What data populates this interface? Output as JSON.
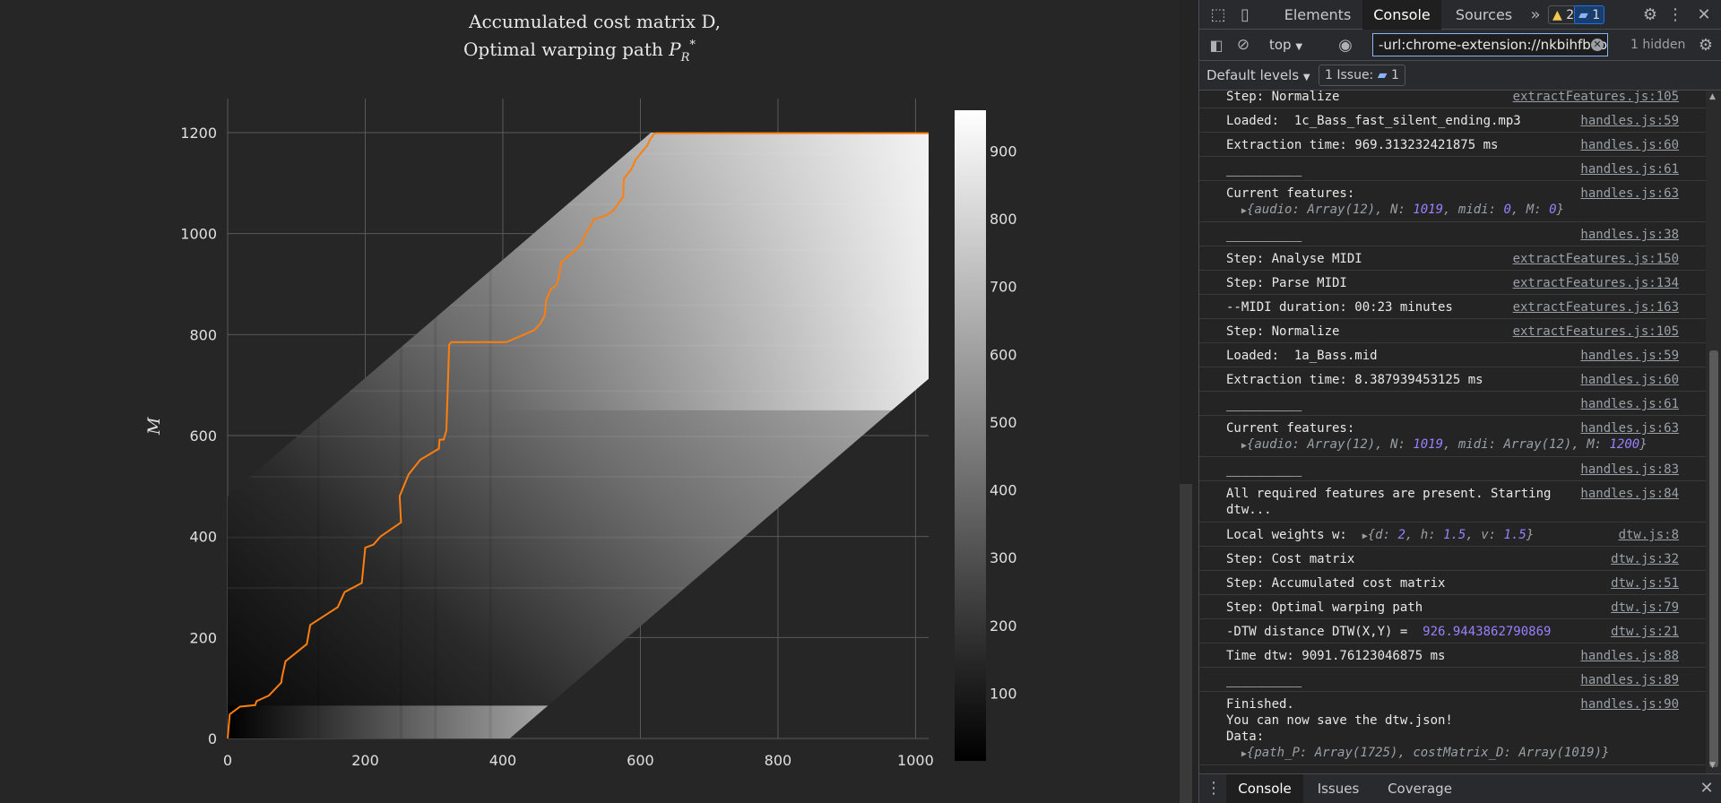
{
  "chart_data": {
    "type": "heatmap",
    "title_line1": "Accumulated cost matrix D,",
    "title_line2": "Optimal warping path P*_R",
    "xlabel": "",
    "ylabel": "M",
    "xlim": [
      0,
      1019
    ],
    "ylim": [
      0,
      1200
    ],
    "x_ticks": [
      "0",
      "200",
      "400",
      "600",
      "800",
      "1000"
    ],
    "y_ticks": [
      "0",
      "200",
      "400",
      "600",
      "800",
      "1000",
      "1200"
    ],
    "colorbar_ticks": [
      "100",
      "200",
      "300",
      "400",
      "500",
      "600",
      "700",
      "800",
      "900"
    ],
    "colorbar_range": [
      0,
      960
    ],
    "colormap": "greys",
    "grid": true,
    "path_color": "#ff7f0e",
    "band": {
      "lower_intercept_x": 410,
      "upper_intercept_y": 480,
      "slope": 1.17
    },
    "warping_path": [
      [
        0,
        0
      ],
      [
        3,
        48
      ],
      [
        18,
        63
      ],
      [
        40,
        66
      ],
      [
        42,
        74
      ],
      [
        60,
        85
      ],
      [
        78,
        111
      ],
      [
        79,
        121
      ],
      [
        84,
        153
      ],
      [
        115,
        187
      ],
      [
        120,
        225
      ],
      [
        160,
        260
      ],
      [
        170,
        290
      ],
      [
        195,
        308
      ],
      [
        200,
        378
      ],
      [
        212,
        384
      ],
      [
        222,
        400
      ],
      [
        252,
        428
      ],
      [
        250,
        480
      ],
      [
        263,
        523
      ],
      [
        280,
        552
      ],
      [
        307,
        574
      ],
      [
        308,
        592
      ],
      [
        314,
        592
      ],
      [
        318,
        610
      ],
      [
        322,
        780
      ],
      [
        325,
        785
      ],
      [
        404,
        785
      ],
      [
        405,
        785
      ],
      [
        446,
        809
      ],
      [
        455,
        823
      ],
      [
        461,
        838
      ],
      [
        463,
        868
      ],
      [
        470,
        890
      ],
      [
        478,
        898
      ],
      [
        482,
        918
      ],
      [
        485,
        943
      ],
      [
        514,
        978
      ],
      [
        520,
        1000
      ],
      [
        528,
        1016
      ],
      [
        532,
        1028
      ],
      [
        550,
        1036
      ],
      [
        560,
        1045
      ],
      [
        575,
        1073
      ],
      [
        576,
        1109
      ],
      [
        587,
        1128
      ],
      [
        593,
        1146
      ],
      [
        601,
        1160
      ],
      [
        610,
        1174
      ],
      [
        613,
        1184
      ],
      [
        620,
        1198
      ],
      [
        623,
        1199
      ],
      [
        1019,
        1199
      ]
    ]
  },
  "devtools": {
    "tabs": [
      "Elements",
      "Console",
      "Sources"
    ],
    "warning_count": "2",
    "info_count": "1",
    "context": "top",
    "filter_value": "-url:chrome-extension://nkbihfbeog",
    "hidden_count": "1 hidden",
    "levels": "Default levels",
    "issues_label": "1 Issue:",
    "issues_count": "1",
    "drawer_tabs": [
      "Console",
      "Issues",
      "Coverage"
    ]
  },
  "console": [
    {
      "text": "Step: Normalize",
      "src": "extractFeatures.js:105"
    },
    {
      "text": "Loaded:  1c_Bass_fast_silent_ending.mp3",
      "src": "handles.js:59"
    },
    {
      "text": "Extraction time: 969.313232421875 ms",
      "src": "handles.js:60"
    },
    {
      "text": "__________",
      "src": "handles.js:61"
    },
    {
      "text": "Current features:",
      "src": "handles.js:63",
      "obj": [
        "{audio: Array(12), N: ",
        "1019",
        ", midi: ",
        "0",
        ", M: ",
        "0",
        "}"
      ]
    },
    {
      "text": "__________",
      "src": "handles.js:38"
    },
    {
      "text": "Step: Analyse MIDI",
      "src": "extractFeatures.js:150"
    },
    {
      "text": "Step: Parse MIDI",
      "src": "extractFeatures.js:134"
    },
    {
      "text": "--MIDI duration: 00:23 minutes",
      "src": "extractFeatures.js:163"
    },
    {
      "text": "Step: Normalize",
      "src": "extractFeatures.js:105"
    },
    {
      "text": "Loaded:  1a_Bass.mid",
      "src": "handles.js:59"
    },
    {
      "text": "Extraction time: 8.387939453125 ms",
      "src": "handles.js:60"
    },
    {
      "text": "__________",
      "src": "handles.js:61"
    },
    {
      "text": "Current features:",
      "src": "handles.js:63",
      "obj": [
        "{audio: Array(12), N: ",
        "1019",
        ", midi: Array(12), M: ",
        "1200",
        "}"
      ]
    },
    {
      "text": "__________",
      "src": "handles.js:83"
    },
    {
      "text": "All required features are present. Starting\ndtw...",
      "src": "handles.js:84"
    },
    {
      "text": "Local weights w:  ",
      "src": "dtw.js:8",
      "inline_obj": [
        "{d: ",
        "2",
        ", h: ",
        "1.5",
        ", v: ",
        "1.5",
        "}"
      ]
    },
    {
      "text": "Step: Cost matrix",
      "src": "dtw.js:32"
    },
    {
      "text": "Step: Accumulated cost matrix",
      "src": "dtw.js:51"
    },
    {
      "text": "Step: Optimal warping path",
      "src": "dtw.js:79"
    },
    {
      "text": "-DTW distance DTW(X,Y) =  ",
      "src": "dtw.js:21",
      "value": "926.9443862790869"
    },
    {
      "text": "Time dtw: 9091.76123046875 ms",
      "src": "handles.js:88"
    },
    {
      "text": "__________",
      "src": "handles.js:89"
    },
    {
      "text": "Finished.\nYou can now save the dtw.json!\nData:",
      "src": "handles.js:90",
      "obj": [
        "{path_P: Array(1725), costMatrix_D: Array(1019)}"
      ]
    }
  ],
  "console_prompt": "›"
}
